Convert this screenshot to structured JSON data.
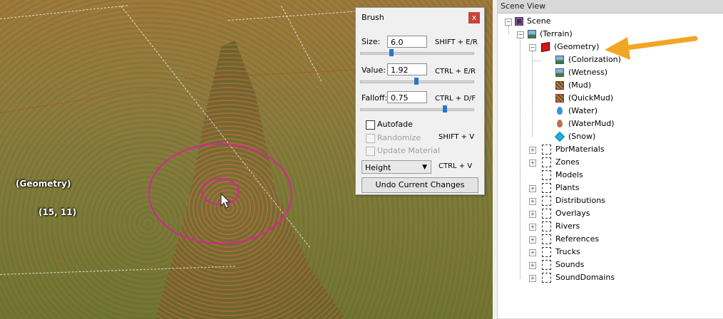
{
  "viewport": {
    "geometry_label": "(Geometry)",
    "coords_label": "(15, 11)"
  },
  "brush_panel": {
    "title": "Brush",
    "close": "x",
    "size": {
      "label": "Size:",
      "value": "6.0",
      "shortcut": "SHIFT + E/R",
      "slider_fraction": 0.28
    },
    "value": {
      "label": "Value:",
      "value": "1.92",
      "shortcut": "CTRL + E/R",
      "slider_fraction": 0.5
    },
    "falloff": {
      "label": "Falloff:",
      "value": "0.75",
      "shortcut": "CTRL + D/F",
      "slider_fraction": 0.75
    },
    "autofade": {
      "label": "Autofade",
      "checked": false
    },
    "randomize": {
      "label": "Randomize",
      "shortcut": "SHIFT + V",
      "enabled": false
    },
    "update_material": {
      "label": "Update Material",
      "enabled": false
    },
    "mode_select": {
      "value": "Height",
      "shortcut": "CTRL + V"
    },
    "undo_button": "Undo Current Changes"
  },
  "scene_view": {
    "header": "Scene View",
    "root": "Scene",
    "terrain": "(Terrain)",
    "geometry": "(Geometry)",
    "geometry_children": [
      "(Colorization)",
      "(Wetness)",
      "(Mud)",
      "(QuickMud)",
      "(Water)",
      "(WaterMud)",
      "(Snow)"
    ],
    "folders": [
      "PbrMaterials",
      "Zones",
      "Models",
      "Plants",
      "Distributions",
      "Overlays",
      "Rivers",
      "References",
      "Trucks",
      "Sounds",
      "SoundDomains"
    ]
  },
  "colors": {
    "brush_circle": "#d5259a",
    "arrow": "#f2a623",
    "slider_thumb": "#2677d1",
    "close_button": "#c8423b"
  }
}
